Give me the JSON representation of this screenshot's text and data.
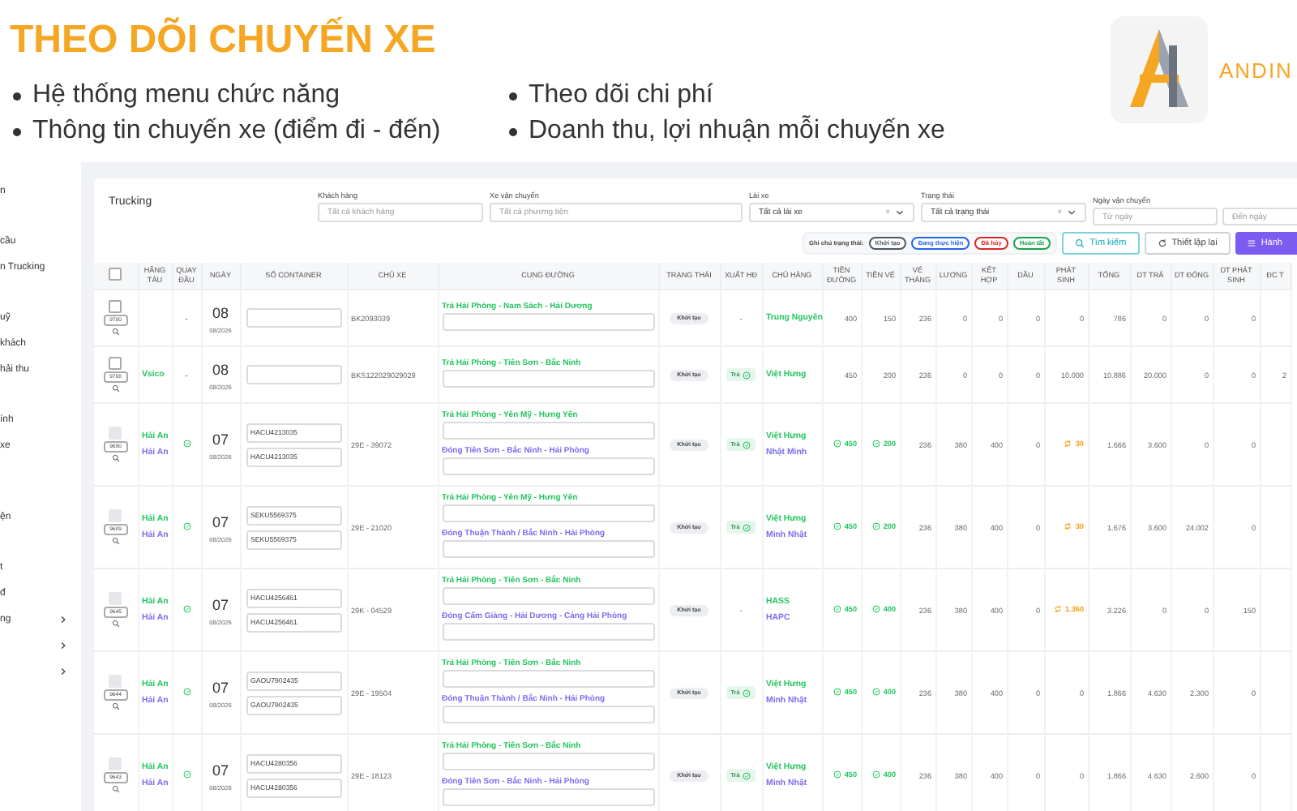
{
  "slide": {
    "title": "THEO DÕI CHUYẾN XE",
    "bullets": [
      "Hệ thống menu chức năng",
      "Theo dõi chi phí",
      "Thông tin chuyến xe (điểm đi - đến)",
      "Doanh thu, lợi nhuận mỗi chuyến xe"
    ],
    "brand": "ANDIN"
  },
  "sidebar": {
    "sections": [
      [
        {
          "label": "n"
        }
      ],
      [
        {
          "label": "cầu"
        },
        {
          "label": "n Trucking"
        }
      ],
      [
        {
          "label": "uỹ"
        },
        {
          "label": "khách"
        },
        {
          "label": "hải thu"
        }
      ],
      [
        {
          "label": "ính"
        },
        {
          "label": "xe"
        }
      ],
      [
        {
          "label": "ện"
        }
      ],
      [
        {
          "label": "t"
        },
        {
          "label": "đ"
        },
        {
          "label": "ng",
          "expandable": true
        },
        {
          "expandable": true
        },
        {
          "expandable": true
        }
      ]
    ]
  },
  "page": {
    "title": "Trucking",
    "filters": [
      {
        "label": "Khách hàng",
        "kind": "text",
        "placeholder": "Tất cả khách hàng"
      },
      {
        "label": "Xe vận chuyển",
        "kind": "text",
        "placeholder": "Tất cả phương tiện"
      },
      {
        "label": "Lái xe",
        "kind": "select",
        "value": "Tất cả lái xe",
        "clear": "×"
      },
      {
        "label": "Trạng thái",
        "kind": "select",
        "value": "Tất cả trạng thái",
        "clear": "×"
      },
      {
        "label": "Ngày vận chuyển",
        "kind": "range",
        "placeholders": [
          "Từ ngày",
          "Đến ngày"
        ]
      }
    ],
    "legend": {
      "label": "Ghi chú trạng thái:",
      "items": [
        {
          "label": "Khởi tạo",
          "color": "#4b5563"
        },
        {
          "label": "Đang thực hiện",
          "color": "#2563eb"
        },
        {
          "label": "Đã hủy",
          "color": "#dc2626"
        },
        {
          "label": "Hoàn tất",
          "color": "#16a34a"
        }
      ]
    },
    "buttons": [
      {
        "label": "Tìm kiếm",
        "kind": "search"
      },
      {
        "label": "Thiết lập lại",
        "kind": "reset"
      },
      {
        "label": "Hành",
        "kind": "primary"
      }
    ]
  },
  "table": {
    "columns": [
      {
        "kind": "checkbox",
        "checked": false
      },
      {
        "kind": "text",
        "label": "HÃNG TÀU"
      },
      {
        "kind": "text",
        "label": "QUAY ĐẦU"
      },
      {
        "kind": "text",
        "label": "NGÀY"
      },
      {
        "kind": "text",
        "label": "SỐ CONTAINER"
      },
      {
        "kind": "text",
        "label": "CHỦ XE"
      },
      {
        "kind": "text",
        "label": "CUNG ĐƯỜNG"
      },
      {
        "kind": "text",
        "label": "TRẠNG THÁI"
      },
      {
        "kind": "text",
        "label": "XUẤT HĐ"
      },
      {
        "kind": "text",
        "label": "CHỦ HÀNG"
      },
      {
        "kind": "text",
        "label": "TIỀN ĐƯỜNG"
      },
      {
        "kind": "text",
        "label": "TIỀN VÉ"
      },
      {
        "kind": "text",
        "label": "VÉ THÁNG"
      },
      {
        "kind": "text",
        "label": "LƯƠNG"
      },
      {
        "kind": "text",
        "label": "KẾT HỢP"
      },
      {
        "kind": "text",
        "label": "DẦU"
      },
      {
        "kind": "text",
        "label": "PHÁT SINH"
      },
      {
        "kind": "text",
        "label": "TỔNG"
      },
      {
        "kind": "text",
        "label": "DT TRẢ"
      },
      {
        "kind": "text",
        "label": "DT ĐÓNG"
      },
      {
        "kind": "text",
        "label": "DT PHÁT SINH"
      },
      {
        "kind": "text",
        "label": "ĐC T"
      }
    ],
    "rows": [
      {
        "id": "9780",
        "checked": false,
        "disabled": false,
        "carriers": [],
        "turnaround": {
          "kind": "dash",
          "label": "-"
        },
        "day": "08",
        "month": "08/2026",
        "containers": [
          {
            "kind": "empty"
          }
        ],
        "truck": "BK2093039",
        "routes": [
          {
            "label": "Trả Hải Phòng - Nam Sách - Hải Dương",
            "color": "#22c55e"
          }
        ],
        "status": "Khởi tạo",
        "invoice": {
          "kind": "dash",
          "label": "-"
        },
        "owners": [
          {
            "name": "Trung Nguyên",
            "color": "#22c55e"
          }
        ],
        "amounts": [
          {
            "value": "400",
            "kind": "plain"
          },
          {
            "value": "150",
            "kind": "plain"
          },
          {
            "value": "236",
            "kind": "plain"
          },
          {
            "value": "0",
            "kind": "plain"
          },
          {
            "value": "0",
            "kind": "plain"
          },
          {
            "value": "0",
            "kind": "plain"
          },
          {
            "value": "0",
            "kind": "plain"
          },
          {
            "value": "786",
            "kind": "plain"
          },
          {
            "value": "0",
            "kind": "plain"
          },
          {
            "value": "0",
            "kind": "plain"
          },
          {
            "value": "0",
            "kind": "plain"
          }
        ]
      },
      {
        "id": "9788",
        "checked": false,
        "disabled": false,
        "carriers": [
          {
            "name": "Vsico",
            "color": "#22c55e"
          }
        ],
        "turnaround": {
          "kind": "dash",
          "label": "-"
        },
        "day": "08",
        "month": "08/2026",
        "containers": [
          {
            "kind": "empty"
          }
        ],
        "truck": "BKS122029029029",
        "routes": [
          {
            "label": "Trả Hải Phòng - Tiên Sơn - Bắc Ninh",
            "color": "#22c55e"
          }
        ],
        "status": "Khởi tạo",
        "invoice": {
          "kind": "badge",
          "label": "Trả"
        },
        "owners": [
          {
            "name": "Việt Hưng",
            "color": "#22c55e"
          }
        ],
        "amounts": [
          {
            "value": "450",
            "kind": "plain"
          },
          {
            "value": "200",
            "kind": "plain"
          },
          {
            "value": "236",
            "kind": "plain"
          },
          {
            "value": "0",
            "kind": "plain"
          },
          {
            "value": "0",
            "kind": "plain"
          },
          {
            "value": "0",
            "kind": "plain"
          },
          {
            "value": "10.000",
            "kind": "plain"
          },
          {
            "value": "10.886",
            "kind": "plain"
          },
          {
            "value": "20.000",
            "kind": "plain"
          },
          {
            "value": "0",
            "kind": "plain"
          },
          {
            "value": "0",
            "kind": "plain"
          }
        ],
        "extra": "2"
      },
      {
        "id": "9690",
        "checked": false,
        "disabled": true,
        "carriers": [
          {
            "name": "Hải An",
            "color": "#22c55e"
          },
          {
            "name": "Hải An",
            "color": "#7c6cf0"
          }
        ],
        "turnaround": {
          "kind": "check"
        },
        "day": "07",
        "month": "08/2026",
        "containers": [
          {
            "kind": "filled",
            "value": "HACU4213035"
          },
          {
            "kind": "filled",
            "value": "HACU4213035"
          }
        ],
        "truck": "29E - 39072",
        "routes": [
          {
            "label": "Trả Hải Phòng - Yên Mỹ - Hưng Yên",
            "color": "#22c55e"
          },
          {
            "label": "Đóng Tiên Sơn - Bắc Ninh - Hải Phòng",
            "color": "#7c6cf0"
          }
        ],
        "status": "Khởi tạo",
        "invoice": {
          "kind": "badge",
          "label": "Trả"
        },
        "owners": [
          {
            "name": "Việt Hưng",
            "color": "#22c55e"
          },
          {
            "name": "Nhật Minh",
            "color": "#7c6cf0"
          }
        ],
        "amounts": [
          {
            "value": "450",
            "kind": "paid"
          },
          {
            "value": "200",
            "kind": "paid"
          },
          {
            "value": "236",
            "kind": "plain"
          },
          {
            "value": "380",
            "kind": "plain"
          },
          {
            "value": "400",
            "kind": "plain"
          },
          {
            "value": "0",
            "kind": "plain"
          },
          {
            "value": "30",
            "kind": "pending"
          },
          {
            "value": "1.666",
            "kind": "plain"
          },
          {
            "value": "3.600",
            "kind": "plain"
          },
          {
            "value": "0",
            "kind": "plain"
          },
          {
            "value": "0",
            "kind": "plain"
          }
        ]
      },
      {
        "id": "9689",
        "checked": false,
        "disabled": true,
        "carriers": [
          {
            "name": "Hải An",
            "color": "#22c55e"
          },
          {
            "name": "Hải An",
            "color": "#7c6cf0"
          }
        ],
        "turnaround": {
          "kind": "check"
        },
        "day": "07",
        "month": "08/2026",
        "containers": [
          {
            "kind": "filled",
            "value": "SEKU5569375"
          },
          {
            "kind": "filled",
            "value": "SEKU5569375"
          }
        ],
        "truck": "29E - 21020",
        "routes": [
          {
            "label": "Trả Hải Phòng - Yên Mỹ - Hưng Yên",
            "color": "#22c55e"
          },
          {
            "label": "Đóng Thuận Thành / Bắc Ninh - Hải Phòng",
            "color": "#7c6cf0"
          }
        ],
        "status": "Khởi tạo",
        "invoice": {
          "kind": "badge",
          "label": "Trả"
        },
        "owners": [
          {
            "name": "Việt Hưng",
            "color": "#22c55e"
          },
          {
            "name": "Minh Nhật",
            "color": "#7c6cf0"
          }
        ],
        "amounts": [
          {
            "value": "450",
            "kind": "paid"
          },
          {
            "value": "200",
            "kind": "paid"
          },
          {
            "value": "236",
            "kind": "plain"
          },
          {
            "value": "380",
            "kind": "plain"
          },
          {
            "value": "400",
            "kind": "plain"
          },
          {
            "value": "0",
            "kind": "plain"
          },
          {
            "value": "30",
            "kind": "pending"
          },
          {
            "value": "1.676",
            "kind": "plain"
          },
          {
            "value": "3.600",
            "kind": "plain"
          },
          {
            "value": "24.002",
            "kind": "plain"
          },
          {
            "value": "0",
            "kind": "plain"
          }
        ]
      },
      {
        "id": "9645",
        "checked": false,
        "disabled": true,
        "carriers": [
          {
            "name": "Hải An",
            "color": "#22c55e"
          },
          {
            "name": "Hải An",
            "color": "#7c6cf0"
          }
        ],
        "turnaround": {
          "kind": "check"
        },
        "day": "07",
        "month": "08/2026",
        "containers": [
          {
            "kind": "filled",
            "value": "HACU4256461"
          },
          {
            "kind": "filled",
            "value": "HACU4256461"
          }
        ],
        "truck": "29K - 04529",
        "routes": [
          {
            "label": "Trả Hải Phòng - Tiên Sơn - Bắc Ninh",
            "color": "#22c55e"
          },
          {
            "label": "Đóng Cẩm Giàng - Hải Dương - Cảng Hải Phòng",
            "color": "#7c6cf0"
          }
        ],
        "status": "Khởi tạo",
        "invoice": {
          "kind": "dash",
          "label": "-"
        },
        "owners": [
          {
            "name": "HASS",
            "color": "#22c55e"
          },
          {
            "name": "HAPC",
            "color": "#7c6cf0"
          }
        ],
        "amounts": [
          {
            "value": "450",
            "kind": "paid"
          },
          {
            "value": "400",
            "kind": "paid"
          },
          {
            "value": "236",
            "kind": "plain"
          },
          {
            "value": "380",
            "kind": "plain"
          },
          {
            "value": "400",
            "kind": "plain"
          },
          {
            "value": "0",
            "kind": "plain"
          },
          {
            "value": "1.360",
            "kind": "pending"
          },
          {
            "value": "3.226",
            "kind": "plain"
          },
          {
            "value": "0",
            "kind": "plain"
          },
          {
            "value": "0",
            "kind": "plain"
          },
          {
            "value": "150",
            "kind": "plain"
          }
        ]
      },
      {
        "id": "9644",
        "checked": false,
        "disabled": true,
        "carriers": [
          {
            "name": "Hải An",
            "color": "#22c55e"
          },
          {
            "name": "Hải An",
            "color": "#7c6cf0"
          }
        ],
        "turnaround": {
          "kind": "check"
        },
        "day": "07",
        "month": "08/2026",
        "containers": [
          {
            "kind": "filled",
            "value": "GAOU7902435"
          },
          {
            "kind": "filled",
            "value": "GAOU7902435"
          }
        ],
        "truck": "29E - 19504",
        "routes": [
          {
            "label": "Trả Hải Phòng - Tiên Sơn - Bắc Ninh",
            "color": "#22c55e"
          },
          {
            "label": "Đóng Thuận Thành / Bắc Ninh - Hải Phòng",
            "color": "#7c6cf0"
          }
        ],
        "status": "Khởi tạo",
        "invoice": {
          "kind": "badge",
          "label": "Trả"
        },
        "owners": [
          {
            "name": "Việt Hưng",
            "color": "#22c55e"
          },
          {
            "name": "Minh Nhật",
            "color": "#7c6cf0"
          }
        ],
        "amounts": [
          {
            "value": "450",
            "kind": "paid"
          },
          {
            "value": "400",
            "kind": "paid"
          },
          {
            "value": "236",
            "kind": "plain"
          },
          {
            "value": "380",
            "kind": "plain"
          },
          {
            "value": "400",
            "kind": "plain"
          },
          {
            "value": "0",
            "kind": "plain"
          },
          {
            "value": "0",
            "kind": "plain"
          },
          {
            "value": "1.866",
            "kind": "plain"
          },
          {
            "value": "4.630",
            "kind": "plain"
          },
          {
            "value": "2.300",
            "kind": "plain"
          },
          {
            "value": "0",
            "kind": "plain"
          }
        ]
      },
      {
        "id": "9643",
        "checked": false,
        "disabled": true,
        "carriers": [
          {
            "name": "Hải An",
            "color": "#22c55e"
          },
          {
            "name": "Hải An",
            "color": "#7c6cf0"
          }
        ],
        "turnaround": {
          "kind": "check"
        },
        "day": "07",
        "month": "08/2026",
        "containers": [
          {
            "kind": "filled",
            "value": "HACU4280356"
          },
          {
            "kind": "filled",
            "value": "HACU4280356"
          }
        ],
        "truck": "29E - 18123",
        "routes": [
          {
            "label": "Trả Hải Phòng - Tiên Sơn - Bắc Ninh",
            "color": "#22c55e"
          },
          {
            "label": "Đóng Tiên Sơn - Bắc Ninh - Hải Phòng",
            "color": "#7c6cf0"
          }
        ],
        "status": "Khởi tạo",
        "invoice": {
          "kind": "badge",
          "label": "Trả"
        },
        "owners": [
          {
            "name": "Việt Hưng",
            "color": "#22c55e"
          },
          {
            "name": "Minh Nhật",
            "color": "#7c6cf0"
          }
        ],
        "amounts": [
          {
            "value": "450",
            "kind": "paid"
          },
          {
            "value": "400",
            "kind": "paid"
          },
          {
            "value": "236",
            "kind": "plain"
          },
          {
            "value": "380",
            "kind": "plain"
          },
          {
            "value": "400",
            "kind": "plain"
          },
          {
            "value": "0",
            "kind": "plain"
          },
          {
            "value": "0",
            "kind": "plain"
          },
          {
            "value": "1.866",
            "kind": "plain"
          },
          {
            "value": "4.630",
            "kind": "plain"
          },
          {
            "value": "2.600",
            "kind": "plain"
          },
          {
            "value": "0",
            "kind": "plain"
          }
        ]
      }
    ]
  }
}
